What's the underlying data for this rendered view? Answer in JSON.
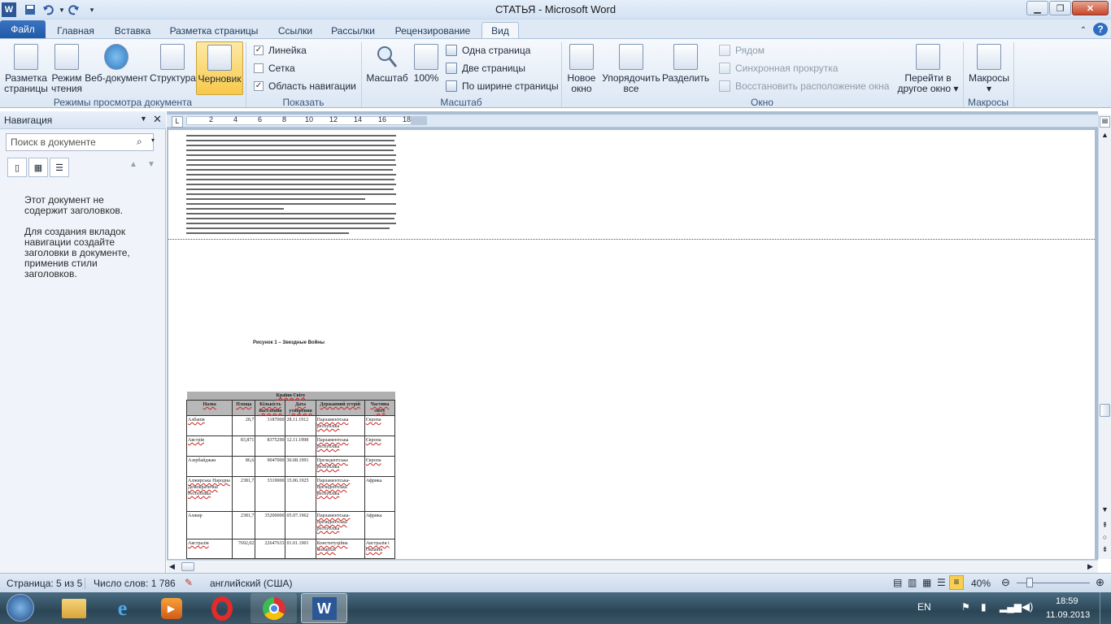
{
  "window": {
    "title": "СТАТЬЯ - Microsoft Word"
  },
  "tabs": [
    {
      "label": "Файл"
    },
    {
      "label": "Главная"
    },
    {
      "label": "Вставка"
    },
    {
      "label": "Разметка страницы"
    },
    {
      "label": "Ссылки"
    },
    {
      "label": "Рассылки"
    },
    {
      "label": "Рецензирование"
    },
    {
      "label": "Вид"
    }
  ],
  "ribbon": {
    "groups": {
      "views": "Режимы просмотра документа",
      "show": "Показать",
      "zoom": "Масштаб",
      "window": "Окно",
      "macros": "Макросы"
    },
    "view_buttons": [
      {
        "label": "Разметка страницы"
      },
      {
        "label": "Режим чтения"
      },
      {
        "label": "Веб-документ"
      },
      {
        "label": "Структура"
      },
      {
        "label": "Черновик"
      }
    ],
    "show_options": [
      {
        "label": "Линейка",
        "checked": true
      },
      {
        "label": "Сетка",
        "checked": false
      },
      {
        "label": "Область навигации",
        "checked": true
      }
    ],
    "zoom_buttons": {
      "zoom": "Масштаб",
      "hundred": "100%"
    },
    "zoom_small": [
      "Одна страница",
      "Две страницы",
      "По ширине страницы"
    ],
    "window_big": [
      "Новое окно",
      "Упорядочить все",
      "Разделить"
    ],
    "window_small": [
      "Рядом",
      "Синхронная прокрутка",
      "Восстановить расположение окна"
    ],
    "switch_window": "Перейти в другое окно",
    "macros": "Макросы"
  },
  "nav": {
    "title": "Навигация",
    "search_placeholder": "Поиск в документе",
    "msg1": "Этот документ не содержит заголовков.",
    "msg2": "Для создания вкладок навигации создайте заголовки в документе, применив стили заголовков."
  },
  "ruler": {
    "ticks": [
      "2",
      "4",
      "6",
      "8",
      "10",
      "12",
      "14",
      "16",
      "18"
    ]
  },
  "document": {
    "figure_caption": "Рисунок 1 – Звездные Войны",
    "table": {
      "caption": "Країни Світу",
      "headers": [
        "Назва",
        "Площа",
        "Кількість населення",
        "Дата утворення",
        "Державний устрій",
        "Частина світу"
      ],
      "rows": [
        [
          "Албанія",
          "28,7",
          "3187000",
          "28.11.1912",
          "Парламентська республіка",
          "Європа"
        ],
        [
          "Австрія",
          "83,871",
          "8375290",
          "12.11.1998",
          "Парламентська республіка",
          "Європа"
        ],
        [
          "Азербайджан",
          "86,6",
          "9047000",
          "30.08.1991",
          "Президентська республіка",
          "Європа"
        ],
        [
          "Алжирська Народна Демократична Республіка",
          "2381,7",
          "3319000",
          "15.06.1925",
          "Парламентська-президентська республіка",
          "Африка"
        ],
        [
          "Алжир",
          "2381,7",
          "35200000",
          "05.07.1962",
          "Парламентська-президентська республіка",
          "Африка"
        ],
        [
          "Австралія",
          "7692,02",
          "22647633",
          "01.01.1901",
          "Конституційна монархія",
          "Австралія і Океанія"
        ]
      ]
    }
  },
  "status": {
    "page": "Страница: 5 из 5",
    "words": "Число слов: 1 786",
    "language": "английский (США)",
    "zoom": "40%"
  },
  "taskbar": {
    "lang": "EN",
    "time": "18:59",
    "date": "11.09.2013"
  }
}
